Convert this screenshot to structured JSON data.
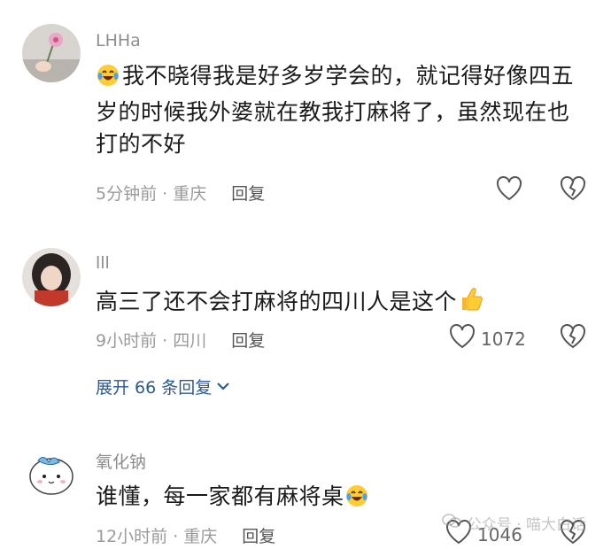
{
  "comments": [
    {
      "username": "LHHa",
      "text": "我不晓得我是好多岁学会的，就记得好像四五岁的时候我外婆就在教我打麻将了，虽然现在也打的不好",
      "time_location": "5分钟前 · 重庆",
      "reply_label": "回复",
      "like_count": "",
      "leading_emoji": "laugh-cry-emoji"
    },
    {
      "username": "lll",
      "text": "高三了还不会打麻将的四川人是这个",
      "time_location": "9小时前 · 四川",
      "reply_label": "回复",
      "like_count": "1072",
      "trailing_emoji": "thumbs-up-emoji"
    },
    {
      "username": "氧化钠",
      "text": "谁懂，每一家都有麻将桌",
      "time_location": "12小时前 · 重庆",
      "reply_label": "回复",
      "like_count": "1046",
      "trailing_emoji": "laugh-cry-emoji"
    }
  ],
  "expand_replies": "展开 66 条回复",
  "watermark": "公众号 · 喵大白话",
  "colors": {
    "link": "#2a5a93",
    "meta": "#9a9a9a",
    "text": "#1a1a1a"
  }
}
